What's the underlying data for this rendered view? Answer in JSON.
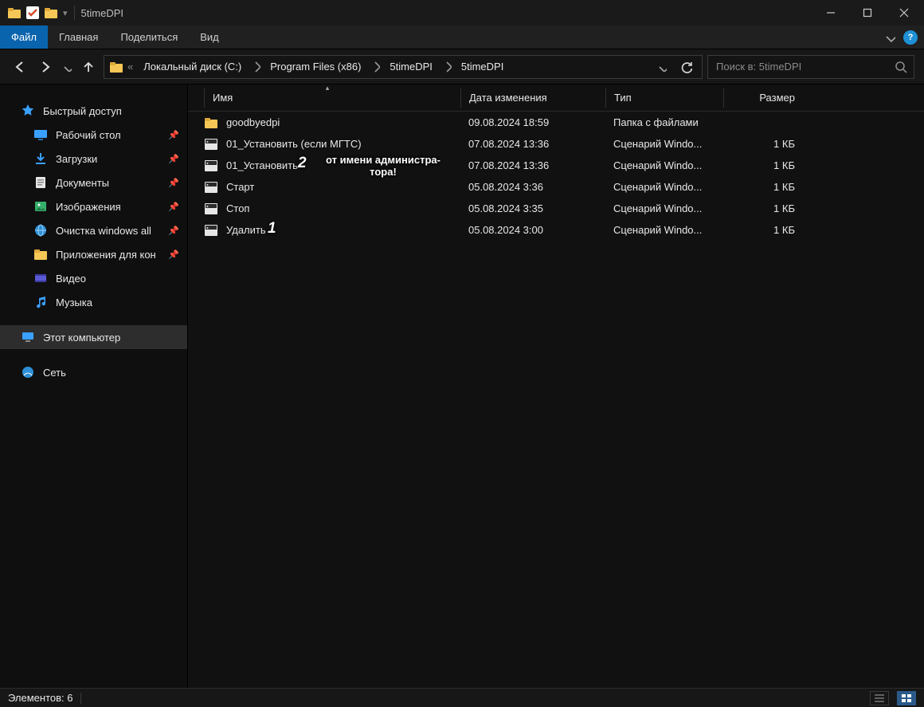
{
  "window": {
    "title": "5timeDPI"
  },
  "ribbon": {
    "file": "Файл",
    "tabs": [
      "Главная",
      "Поделиться",
      "Вид"
    ]
  },
  "breadcrumb": [
    "Локальный диск (C:)",
    "Program Files (x86)",
    "5timeDPI",
    "5timeDPI"
  ],
  "search": {
    "placeholder": "Поиск в: 5timeDPI"
  },
  "sidebar": {
    "quick": "Быстрый доступ",
    "quick_items": [
      {
        "label": "Рабочий стол",
        "icon": "desktop",
        "pinned": true
      },
      {
        "label": "Загрузки",
        "icon": "downloads",
        "pinned": true
      },
      {
        "label": "Документы",
        "icon": "documents",
        "pinned": true
      },
      {
        "label": "Изображения",
        "icon": "pictures",
        "pinned": true
      },
      {
        "label": "Очистка windows all",
        "icon": "globe",
        "pinned": true
      },
      {
        "label": "Приложения для кон",
        "icon": "folder",
        "pinned": true
      },
      {
        "label": "Видео",
        "icon": "video",
        "pinned": false
      },
      {
        "label": "Музыка",
        "icon": "music",
        "pinned": false
      }
    ],
    "thispc": "Этот компьютер",
    "network": "Сеть"
  },
  "columns": {
    "name": "Имя",
    "date": "Дата изменения",
    "type": "Тип",
    "size": "Размер"
  },
  "files": [
    {
      "name": "goodbyedpi",
      "date": "09.08.2024 18:59",
      "type": "Папка с файлами",
      "size": "",
      "icon": "folder"
    },
    {
      "name": "01_Установить (если МГТС)",
      "date": "07.08.2024 13:36",
      "type": "Сценарий Windo...",
      "size": "1 КБ",
      "icon": "cmd"
    },
    {
      "name": "01_Установить",
      "date": "07.08.2024 13:36",
      "type": "Сценарий Windo...",
      "size": "1 КБ",
      "icon": "cmd"
    },
    {
      "name": "Старт",
      "date": "05.08.2024 3:36",
      "type": "Сценарий Windo...",
      "size": "1 КБ",
      "icon": "cmd"
    },
    {
      "name": "Стоп",
      "date": "05.08.2024 3:35",
      "type": "Сценарий Windo...",
      "size": "1 КБ",
      "icon": "cmd"
    },
    {
      "name": "Удалить",
      "date": "05.08.2024 3:00",
      "type": "Сценарий Windo...",
      "size": "1 КБ",
      "icon": "cmd"
    }
  ],
  "status": {
    "items": "Элементов: 6"
  },
  "annotations": {
    "n1": "1",
    "n2": "2",
    "admin": "от имени администра-\nтора!"
  }
}
